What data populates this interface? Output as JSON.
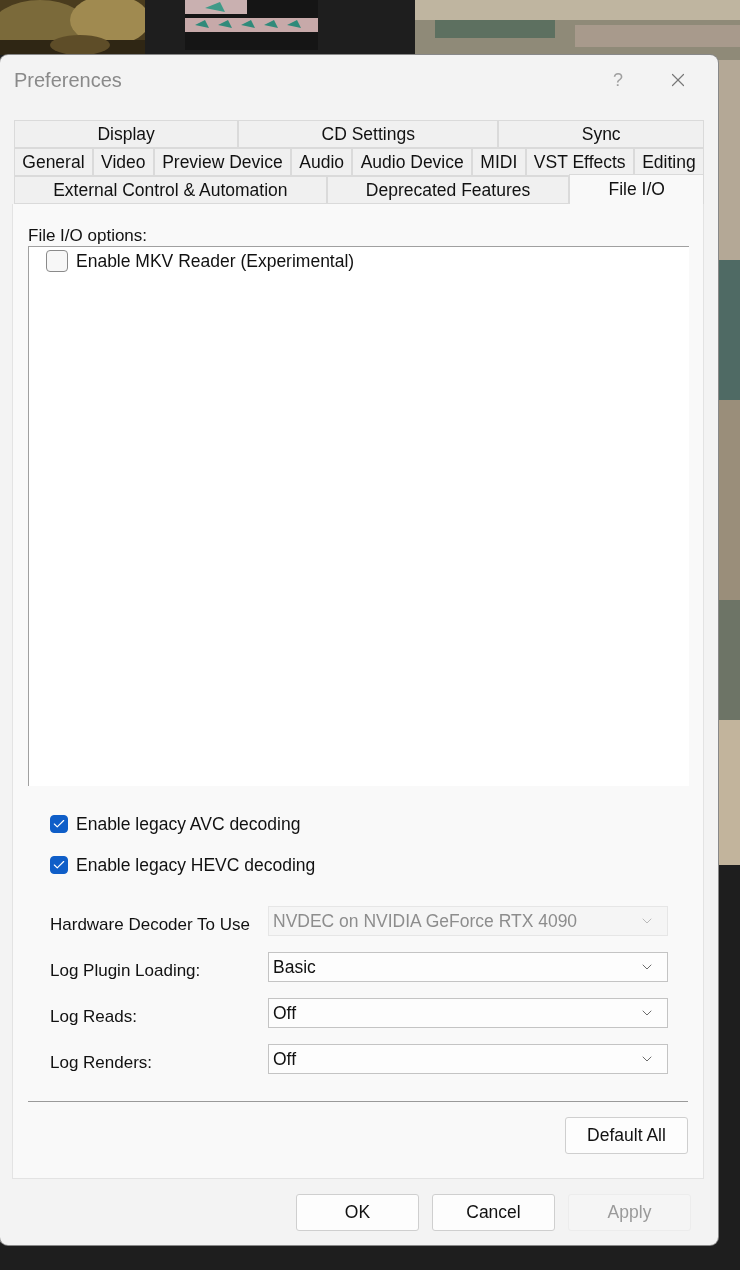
{
  "window": {
    "title": "Preferences",
    "help_button": "?"
  },
  "tab_rows": [
    [
      {
        "label": "Display",
        "selected": false
      },
      {
        "label": "CD Settings",
        "selected": false
      },
      {
        "label": "Sync",
        "selected": false
      }
    ],
    [
      {
        "label": "General",
        "selected": false
      },
      {
        "label": "Video",
        "selected": false
      },
      {
        "label": "Preview Device",
        "selected": false
      },
      {
        "label": "Audio",
        "selected": false
      },
      {
        "label": "Audio Device",
        "selected": false
      },
      {
        "label": "MIDI",
        "selected": false
      },
      {
        "label": "VST Effects",
        "selected": false
      },
      {
        "label": "Editing",
        "selected": false
      }
    ],
    [
      {
        "label": "External Control & Automation",
        "selected": false
      },
      {
        "label": "Deprecated Features",
        "selected": false
      },
      {
        "label": "File I/O",
        "selected": true
      }
    ]
  ],
  "panel": {
    "list_label": "File I/O options:",
    "list_items": [
      {
        "label": "Enable MKV Reader (Experimental)",
        "checked": false
      }
    ],
    "checkboxes": [
      {
        "label": "Enable legacy AVC decoding",
        "checked": true
      },
      {
        "label": "Enable legacy HEVC decoding",
        "checked": true
      }
    ],
    "settings": [
      {
        "label": "Hardware Decoder To Use",
        "value": "NVDEC on NVIDIA GeForce RTX 4090",
        "disabled": true
      },
      {
        "label": "Log Plugin Loading:",
        "value": "Basic",
        "disabled": false
      },
      {
        "label": "Log Reads:",
        "value": "Off",
        "disabled": false
      },
      {
        "label": "Log Renders:",
        "value": "Off",
        "disabled": false
      }
    ],
    "default_button": "Default All"
  },
  "buttons": [
    {
      "label": "OK",
      "disabled": false
    },
    {
      "label": "Cancel",
      "disabled": false
    },
    {
      "label": "Apply",
      "disabled": true
    }
  ]
}
